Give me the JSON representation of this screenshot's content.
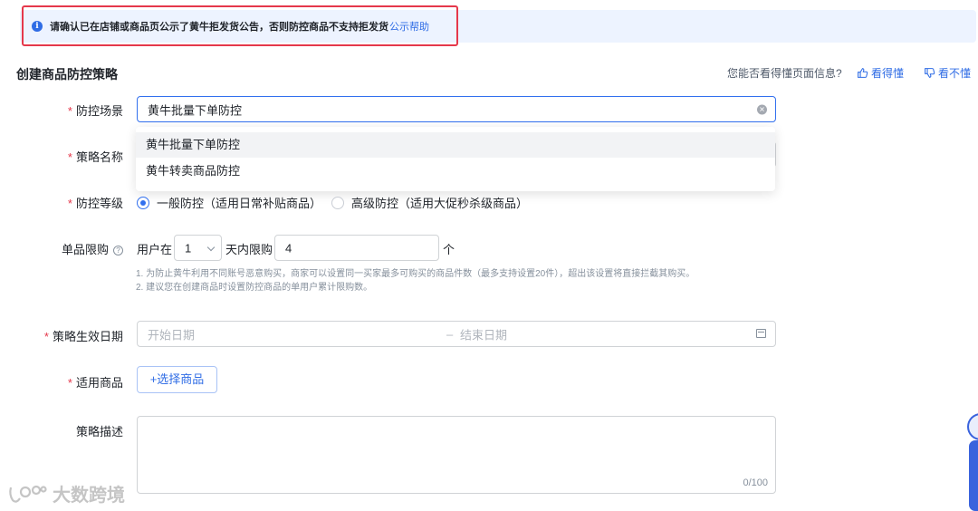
{
  "notice": {
    "text": "请确认已在店铺或商品页公示了黄牛拒发货公告，否则防控商品不支持拒发货",
    "link": "公示帮助"
  },
  "section": {
    "title": "创建商品防控策略",
    "feedback_question": "您能否看得懂页面信息?",
    "feedback_yes": "看得懂",
    "feedback_no": "看不懂"
  },
  "form": {
    "scene": {
      "label": "防控场景",
      "value": "黄牛批量下单防控",
      "options": [
        "黄牛批量下单防控",
        "黄牛转卖商品防控"
      ]
    },
    "name": {
      "label": "策略名称"
    },
    "level": {
      "label": "防控等级",
      "options": [
        "一般防控（适用日常补贴商品）",
        "高级防控（适用大促秒杀级商品）"
      ],
      "selected": "一般防控（适用日常补贴商品）"
    },
    "limit": {
      "label": "单品限购",
      "prefix": "用户在",
      "days_value": "1",
      "middle": "天内限购",
      "count_value": "4",
      "suffix": "个",
      "hint1": "1. 为防止黄牛利用不同账号恶意购买，商家可以设置同一买家最多可购买的商品件数（最多支持设置20件），超出该设置将直接拦截其购买。",
      "hint2": "2. 建议您在创建商品时设置防控商品的单用户累计限购数。"
    },
    "date": {
      "label": "策略生效日期",
      "start_placeholder": "开始日期",
      "separator": "–",
      "end_placeholder": "结束日期"
    },
    "goods": {
      "label": "适用商品",
      "button": "+选择商品"
    },
    "desc": {
      "label": "策略描述",
      "counter": "0/100"
    }
  },
  "watermark": "大数跨境",
  "colors": {
    "primary": "#2f6ce5",
    "required": "#e5384b",
    "notice_bg": "#edf3ff",
    "highlight_border": "#e5384b"
  }
}
